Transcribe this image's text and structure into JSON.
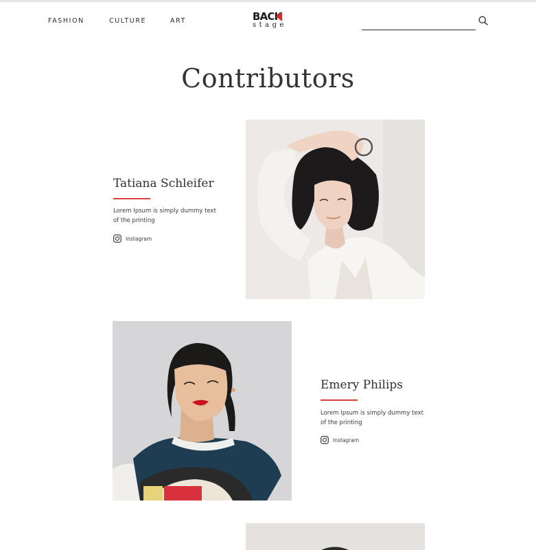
{
  "header": {
    "nav": [
      "FASHION",
      "CULTURE",
      "ART"
    ],
    "logo": {
      "line1": "BACK",
      "line2": "stage"
    },
    "search": {
      "placeholder": ""
    }
  },
  "page": {
    "title": "Contributors"
  },
  "contributors": [
    {
      "name": "Tatiana Schleifer",
      "description": "Lorem Ipsum is simply dummy text of the printing",
      "social_label": "Instagram",
      "social_icon": "instagram-icon"
    },
    {
      "name": "Emery Philips",
      "description": "Lorem Ipsum is simply dummy text of the printing",
      "social_label": "Instagram",
      "social_icon": "instagram-icon"
    }
  ],
  "colors": {
    "accent": "#d6423b",
    "text": "#2b2b2b",
    "logo_flag": "#d32f2f"
  }
}
